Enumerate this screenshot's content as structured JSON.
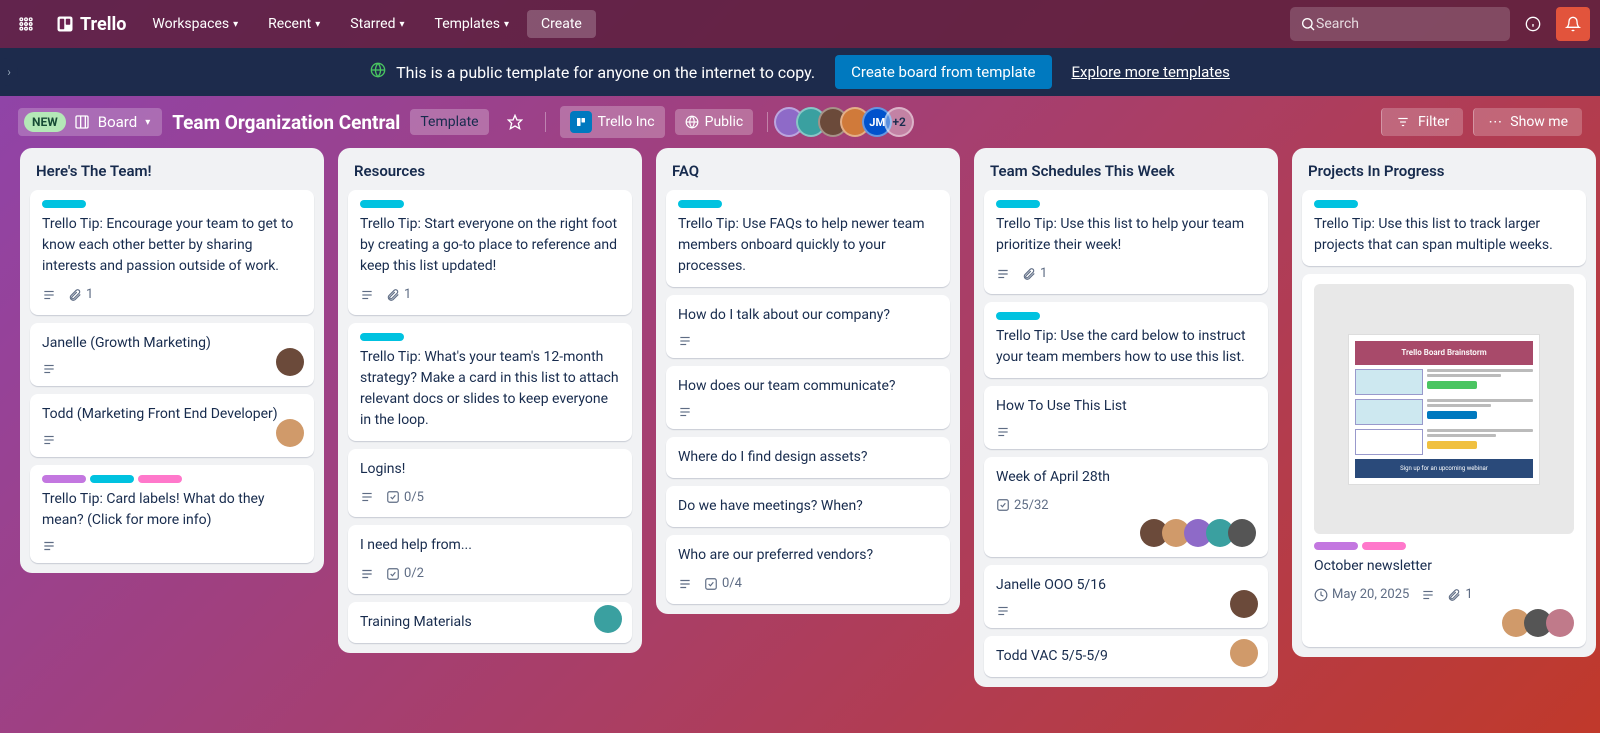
{
  "nav": {
    "brand": "Trello",
    "items": [
      "Workspaces",
      "Recent",
      "Starred",
      "Templates"
    ],
    "create": "Create",
    "search_placeholder": "Search"
  },
  "banner": {
    "text": "This is a public template for anyone on the internet to copy.",
    "cta": "Create board from template",
    "link": "Explore more templates"
  },
  "board_header": {
    "new_badge": "NEW",
    "view_label": "Board",
    "title": "Team Organization Central",
    "template_chip": "Template",
    "workspace": "Trello Inc",
    "visibility": "Public",
    "member_initials": "JM",
    "member_overflow": "+2",
    "filter": "Filter",
    "show_menu": "Show me"
  },
  "lists": [
    {
      "title": "Here's The Team!",
      "cards": [
        {
          "labels": [
            "cyan"
          ],
          "text": "Trello Tip: Encourage your team to get to know each other better by sharing interests and passion outside of work.",
          "meta": {
            "desc": true,
            "attach": "1"
          }
        },
        {
          "text": "Janelle (Growth Marketing)",
          "meta": {
            "desc": true
          },
          "avatar": "a1"
        },
        {
          "text": "Todd (Marketing Front End Developer)",
          "meta": {
            "desc": true
          },
          "avatar": "a2"
        },
        {
          "labels": [
            "purple",
            "cyan",
            "pink"
          ],
          "text": "Trello Tip: Card labels! What do they mean? (Click for more info)",
          "meta": {
            "desc": true
          }
        }
      ]
    },
    {
      "title": "Resources",
      "cards": [
        {
          "labels": [
            "cyan"
          ],
          "text": "Trello Tip: Start everyone on the right foot by creating a go-to place to reference and keep this list updated!",
          "meta": {
            "desc": true,
            "attach": "1"
          }
        },
        {
          "labels": [
            "cyan"
          ],
          "text": "Trello Tip: What's your team's 12-month strategy? Make a card in this list to attach relevant docs or slides to keep everyone in the loop."
        },
        {
          "text": "Logins!",
          "meta": {
            "desc": true,
            "check": "0/5"
          }
        },
        {
          "text": "I need help from...",
          "meta": {
            "desc": true,
            "check": "0/2"
          }
        },
        {
          "text": "Training Materials",
          "avatar": "a3"
        }
      ]
    },
    {
      "title": "FAQ",
      "cards": [
        {
          "labels": [
            "cyan"
          ],
          "text": "Trello Tip: Use FAQs to help newer team members onboard quickly to your processes."
        },
        {
          "text": "How do I talk about our company?",
          "meta": {
            "desc": true
          }
        },
        {
          "text": "How does our team communicate?",
          "meta": {
            "desc": true
          }
        },
        {
          "text": "Where do I find design assets?"
        },
        {
          "text": "Do we have meetings? When?"
        },
        {
          "text": "Who are our preferred vendors?",
          "meta": {
            "desc": true,
            "check": "0/4"
          }
        }
      ]
    },
    {
      "title": "Team Schedules This Week",
      "cards": [
        {
          "labels": [
            "cyan"
          ],
          "text": "Trello Tip: Use this list to help your team prioritize their week!",
          "meta": {
            "desc": true,
            "attach": "1"
          }
        },
        {
          "labels": [
            "cyan"
          ],
          "text": "Trello Tip: Use the card below to instruct your team members how to use this list."
        },
        {
          "text": "How To Use This List",
          "meta": {
            "desc": true
          }
        },
        {
          "text": "Week of April 28th",
          "meta": {
            "check": "25/32"
          },
          "avatars": [
            "a1",
            "a2",
            "a4",
            "a3",
            "a5"
          ]
        },
        {
          "text": "Janelle OOO 5/16",
          "meta": {
            "desc": true
          },
          "avatar": "a1"
        },
        {
          "text": "Todd VAC 5/5-5/9",
          "avatar": "a2"
        }
      ]
    },
    {
      "title": "Projects In Progress",
      "cards": [
        {
          "labels": [
            "cyan"
          ],
          "text": "Trello Tip: Use this list to track larger projects that can span multiple weeks."
        },
        {
          "image": true,
          "image_title": "Trello Board Brainstorm",
          "labels_below": [
            "purple",
            "pink"
          ],
          "text": "October newsletter",
          "meta": {
            "date": "May 20, 2025",
            "desc": true,
            "attach": "1"
          },
          "avatars": [
            "a2",
            "a5",
            "a6"
          ]
        }
      ]
    }
  ]
}
